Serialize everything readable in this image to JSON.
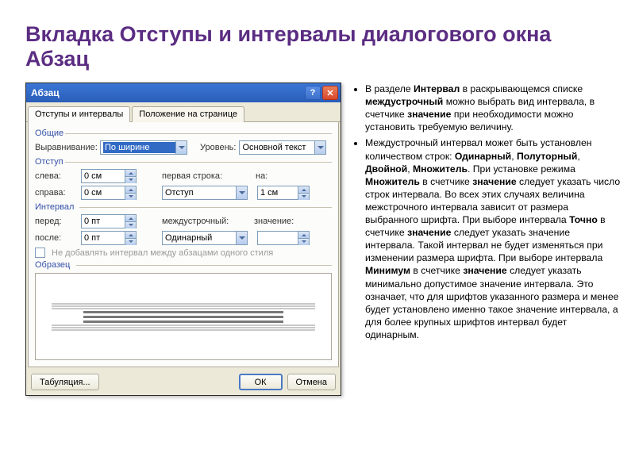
{
  "slide": {
    "title": "Вкладка Отступы и интервалы диалогового окна Абзац",
    "bullets": [
      "В разделе <b>Интервал</b> в раскрывающемся списке <b>междустрочный</b> можно выбрать вид интервала, в счетчике <b>значение</b> при необходимости можно установить требуемую величину.",
      "Междустрочный интервал может быть установлен количеством строк: <b>Одинарный</b>, <b>Полуторный</b>, <b>Двойной</b>, <b>Множитель</b>. При установке режима <b>Множитель</b> в счетчике <b>значение</b> следует указать число строк интервала. Во всех этих случаях величина межстрочного интервала зависит от размера выбранного шрифта. При выборе интервала <b>Точно</b> в счетчике <b>значение</b> следует указать значение интервала. Такой интервал не будет изменяться при изменении размера шрифта. При выборе интервала <b>Минимум</b> в счетчике <b>значение</b> следует указать минимально допустимое значение интервала. Это означает, что для шрифтов указанного размера и менее будет установлено именно такое значение интервала, а для более крупных шрифтов интервал будет одинарным."
    ]
  },
  "dialog": {
    "title": "Абзац",
    "tabs": {
      "t1": "Отступы и интервалы",
      "t2": "Положение на странице"
    },
    "general": {
      "legend": "Общие",
      "align_label": "Выравнивание:",
      "align_value": "По ширине",
      "level_label": "Уровень:",
      "level_value": "Основной текст"
    },
    "indent": {
      "legend": "Отступ",
      "left_label": "слева:",
      "left_value": "0 см",
      "right_label": "справа:",
      "right_value": "0 см",
      "first_label": "первая строка:",
      "first_value": "Отступ",
      "by_label": "на:",
      "by_value": "1 см"
    },
    "spacing": {
      "legend": "Интервал",
      "before_label": "перед:",
      "before_value": "0 пт",
      "after_label": "после:",
      "after_value": "0 пт",
      "line_label": "междустрочный:",
      "line_value": "Одинарный",
      "at_label": "значение:",
      "at_value": "",
      "no_add": "Не добавлять интервал между абзацами одного стиля"
    },
    "preview_legend": "Образец",
    "buttons": {
      "tabs": "Табуляция...",
      "ok": "ОК",
      "cancel": "Отмена"
    }
  }
}
